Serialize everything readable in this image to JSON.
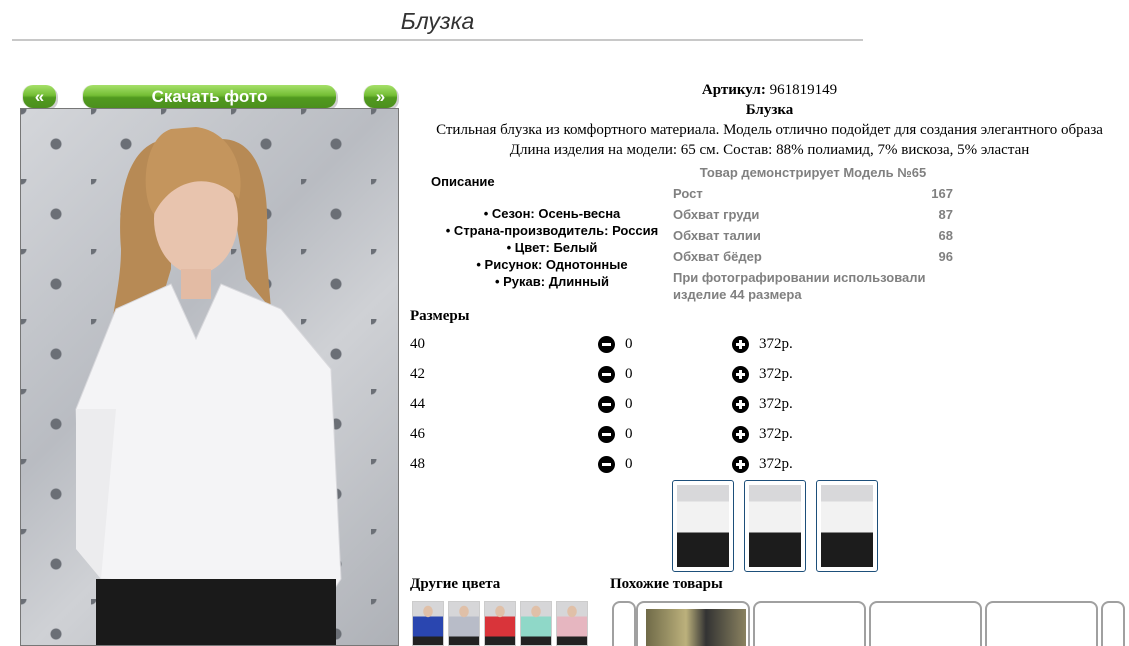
{
  "page": {
    "title": "Блузка"
  },
  "toolbar": {
    "prev_label": "«",
    "download_label": "Скачать фото",
    "next_label": "»"
  },
  "product": {
    "article_label": "Артикул:",
    "article": "961819149",
    "name": "Блузка",
    "description_line1": "Стильная блузка из комфортного материала. Модель отлично подойдет для создания элегантного образа",
    "description_line2": "Длина изделия на модели: 65 см. Состав: 88% полиамид, 7% вискоза, 5% эластан"
  },
  "description": {
    "heading": "Описание",
    "items": [
      "• Сезон: Осень-весна",
      "• Страна-производитель: Россия",
      "• Цвет: Белый",
      "• Рисунок: Однотонные",
      "• Рукав: Длинный"
    ]
  },
  "model": {
    "heading": "Товар демонстрирует Модель №65",
    "rows": [
      {
        "label": "Рост",
        "value": "167"
      },
      {
        "label": "Обхват груди",
        "value": "87"
      },
      {
        "label": "Обхват талии",
        "value": "68"
      },
      {
        "label": "Обхват бёдер",
        "value": "96"
      }
    ],
    "note": "При фотографировании использовали изделие 44 размера"
  },
  "sizes": {
    "heading": "Размеры",
    "rows": [
      {
        "size": "40",
        "qty": "0",
        "price": "372р."
      },
      {
        "size": "42",
        "qty": "0",
        "price": "372р."
      },
      {
        "size": "44",
        "qty": "0",
        "price": "372р."
      },
      {
        "size": "46",
        "qty": "0",
        "price": "372р."
      },
      {
        "size": "48",
        "qty": "0",
        "price": "372р."
      }
    ]
  },
  "other_colors": {
    "heading": "Другие цвета",
    "swatches": [
      "#2a46b0",
      "#b8bcc8",
      "#d9343a",
      "#8fd8c8",
      "#e6b6c0"
    ]
  },
  "similar": {
    "heading": "Похожие товары"
  },
  "colors": {
    "accent_green": "#5aa824",
    "model_text": "#808080",
    "thumb_border": "#1d4f7a"
  }
}
